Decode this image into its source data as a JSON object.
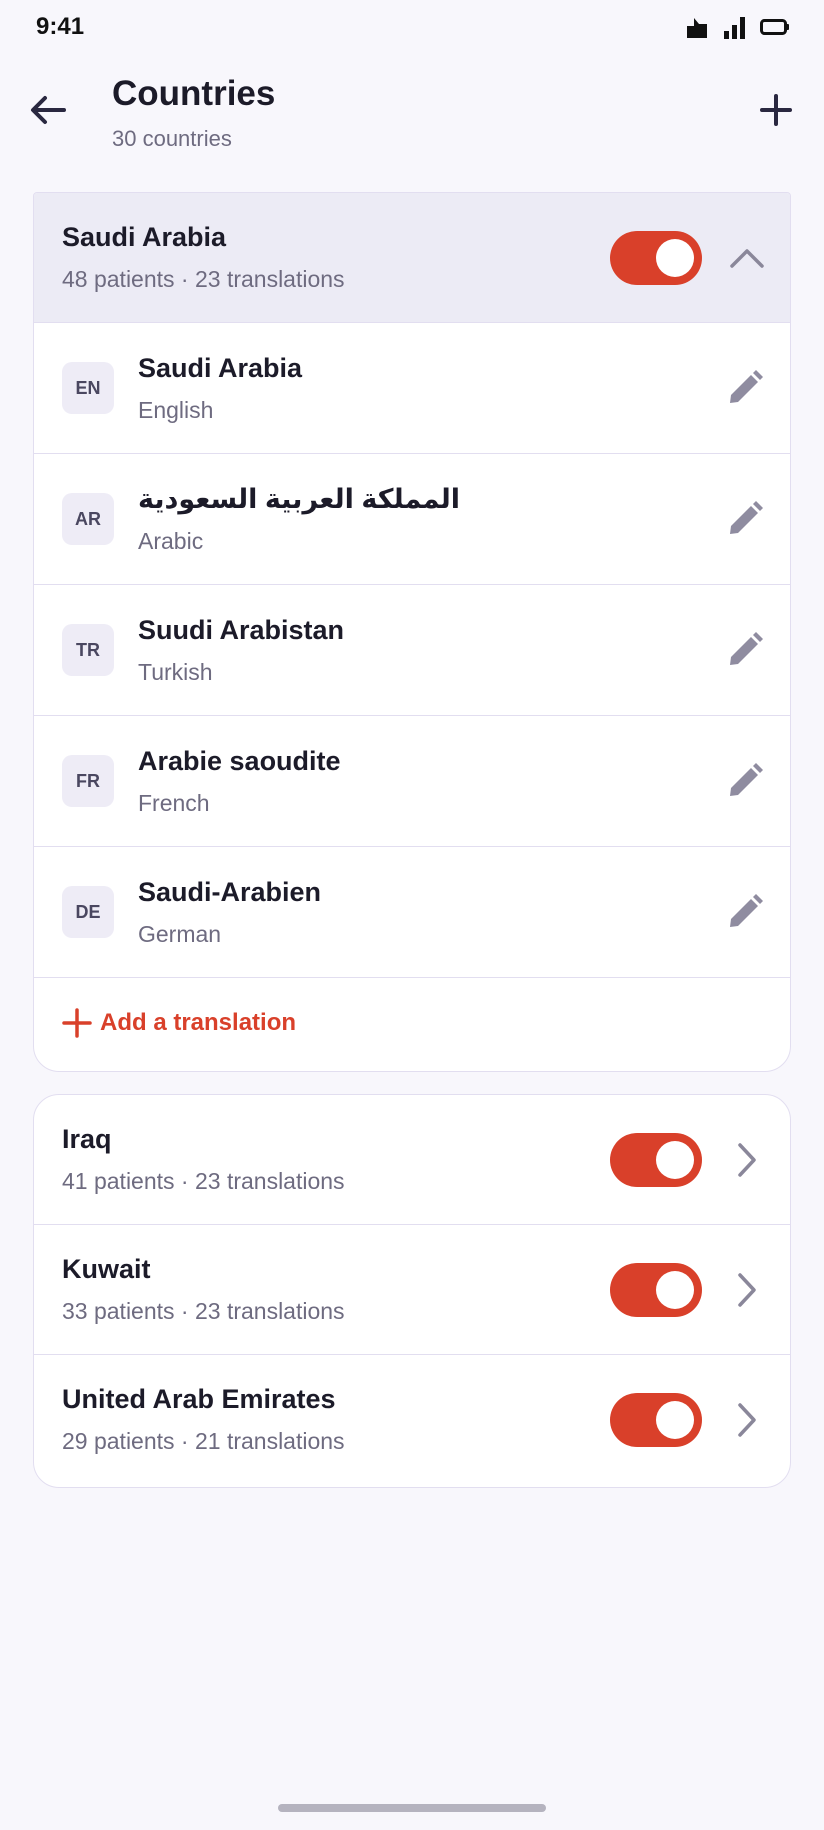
{
  "status_bar": {
    "time": "9:41"
  },
  "header": {
    "title": "Countries",
    "subtitle": "30 countries"
  },
  "icons": {
    "back": "arrow-left-icon",
    "add": "plus-icon",
    "collapse": "chevron-up-icon",
    "open": "chevron-right-icon",
    "edit": "pencil-icon"
  },
  "colors": {
    "accent": "#d9402a",
    "background": "#f8f7fc",
    "expanded_row": "#ecebf5",
    "muted_text": "#6e6b80"
  },
  "expanded_country": {
    "name": "Saudi Arabia",
    "meta": "48 patients · 23 translations",
    "enabled": true,
    "translations": [
      {
        "code": "EN",
        "name": "Saudi Arabia",
        "language": "English"
      },
      {
        "code": "AR",
        "name": "المملكة العربية السعودية",
        "language": "Arabic"
      },
      {
        "code": "TR",
        "name": "Suudi Arabistan",
        "language": "Turkish"
      },
      {
        "code": "FR",
        "name": "Arabie saoudite",
        "language": "French"
      },
      {
        "code": "DE",
        "name": "Saudi-Arabien",
        "language": "German"
      }
    ],
    "add_translation_label": "Add a translation"
  },
  "countries": [
    {
      "name": "Iraq",
      "meta": "41 patients · 23 translations",
      "enabled": true
    },
    {
      "name": "Kuwait",
      "meta": "33 patients · 23 translations",
      "enabled": true
    },
    {
      "name": "United Arab Emirates",
      "meta": "29 patients · 21 translations",
      "enabled": true
    }
  ]
}
